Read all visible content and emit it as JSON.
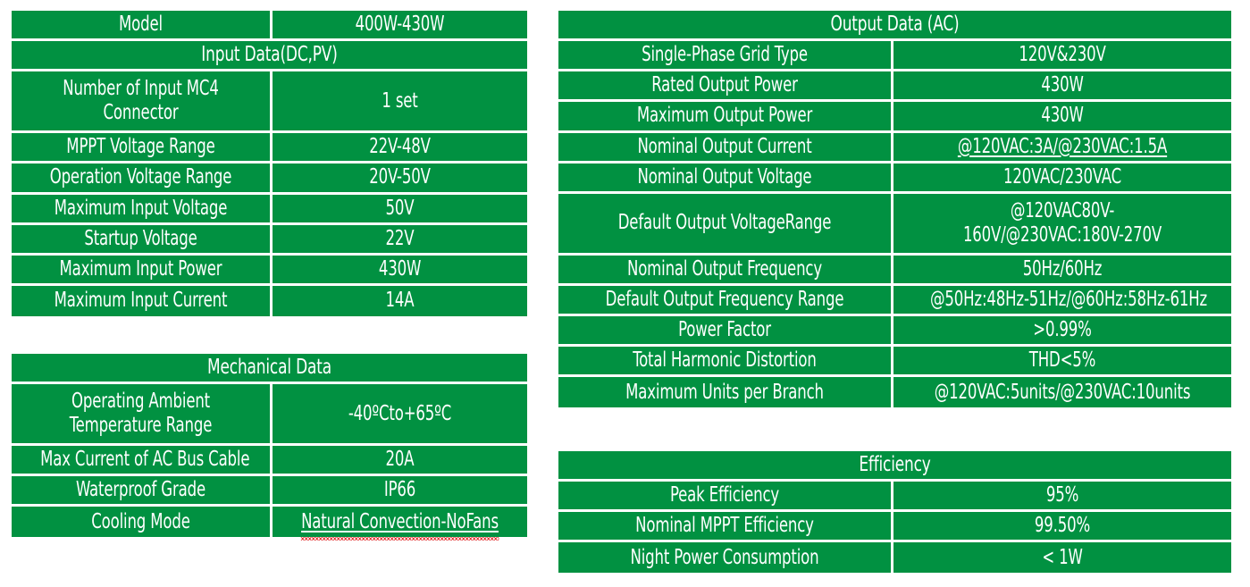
{
  "theme": {
    "cell_fill": "#019141",
    "text_color": "#ffffff",
    "gridline_color": "#ffffff",
    "page_background": "#ffffff",
    "spellcheck_underline_color": "#e02020"
  },
  "tables": {
    "input": {
      "model_label": "Model",
      "model_value": "400W-430W",
      "section_title": "Input Data(DC,PV)",
      "rows": [
        {
          "label": "Number of Input MC4 Connector",
          "value": "1 set"
        },
        {
          "label": "MPPT Voltage Range",
          "value": "22V-48V"
        },
        {
          "label": "Operation Voltage Range",
          "value": "20V-50V"
        },
        {
          "label": "Maximum Input Voltage",
          "value": "50V"
        },
        {
          "label": "Startup Voltage",
          "value": "22V"
        },
        {
          "label": "Maximum Input Power",
          "value": "430W"
        },
        {
          "label": "Maximum Input Current",
          "value": "14A"
        }
      ]
    },
    "mechanical": {
      "section_title": "Mechanical Data",
      "rows": [
        {
          "label": "Operating Ambient Temperature Range",
          "value": "-40ºCto+65ºC"
        },
        {
          "label": "Max Current of AC Bus Cable",
          "value": "20A"
        },
        {
          "label": "Waterproof Grade",
          "value": "IP66"
        },
        {
          "label": "Cooling Mode",
          "value": "Natural Convection-NoFans"
        }
      ]
    },
    "output": {
      "section_title": "Output Data (AC)",
      "rows": [
        {
          "label": "Single-Phase Grid Type",
          "value": "120V&230V"
        },
        {
          "label": "Rated Output Power",
          "value": "430W"
        },
        {
          "label": "Maximum Output Power",
          "value": "430W"
        },
        {
          "label": "Nominal Output Current",
          "value": "@120VAC:3A/@230VAC:1.5A"
        },
        {
          "label": "Nominal Output Voltage",
          "value": "120VAC/230VAC"
        },
        {
          "label": "Default Output VoltageRange",
          "value": "@120VAC80V-160V/@230VAC:180V-270V"
        },
        {
          "label": "Nominal Output Frequency",
          "value": "50Hz/60Hz"
        },
        {
          "label": "Default Output Frequency Range",
          "value": "@50Hz:48Hz-51Hz/@60Hz:58Hz-61Hz"
        },
        {
          "label": "Power Factor",
          "value": ">0.99%"
        },
        {
          "label": "Total Harmonic Distortion",
          "value": "THD<5%"
        },
        {
          "label": "Maximum Units per Branch",
          "value": "@120VAC:5units/@230VAC:10units"
        }
      ]
    },
    "efficiency": {
      "section_title": "Efficiency",
      "rows": [
        {
          "label": "Peak Efficiency",
          "value": "95%"
        },
        {
          "label": "Nominal MPPT Efficiency",
          "value": "99.50%"
        },
        {
          "label": "Night Power Consumption",
          "value": "< 1W"
        }
      ]
    }
  }
}
